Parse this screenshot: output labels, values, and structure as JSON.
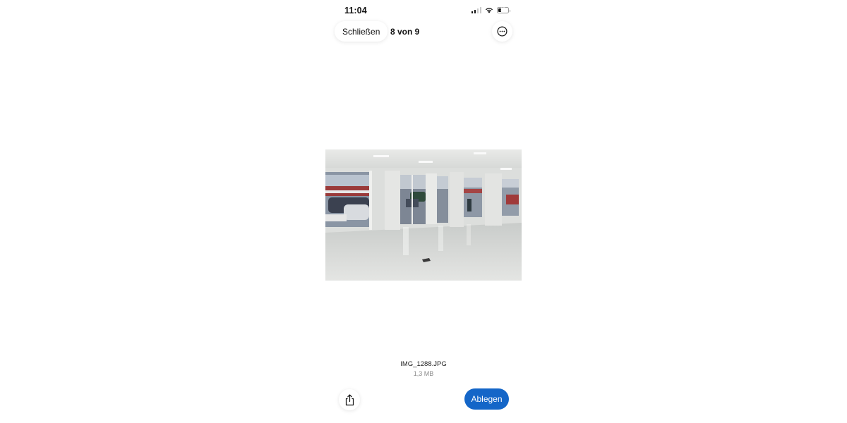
{
  "status_bar": {
    "time": "11:04",
    "battery_level": "27",
    "signal_bars_active": 2,
    "icons": [
      "cellular-signal-icon",
      "wifi-icon",
      "battery-icon"
    ]
  },
  "nav": {
    "close_label": "Schließen",
    "counter": "8 von 9",
    "more_icon": "ellipsis-circle-icon"
  },
  "photo": {
    "description_icon": "photo-image"
  },
  "file": {
    "name": "IMG_1288.JPG",
    "size": "1,3 MB"
  },
  "bottom_bar": {
    "share_icon": "share-icon",
    "drop_label": "Ablegen"
  },
  "colors": {
    "accent": "#1466c8",
    "background": "#ffffff",
    "text": "#111111",
    "secondary_text": "#8a8a8a"
  }
}
